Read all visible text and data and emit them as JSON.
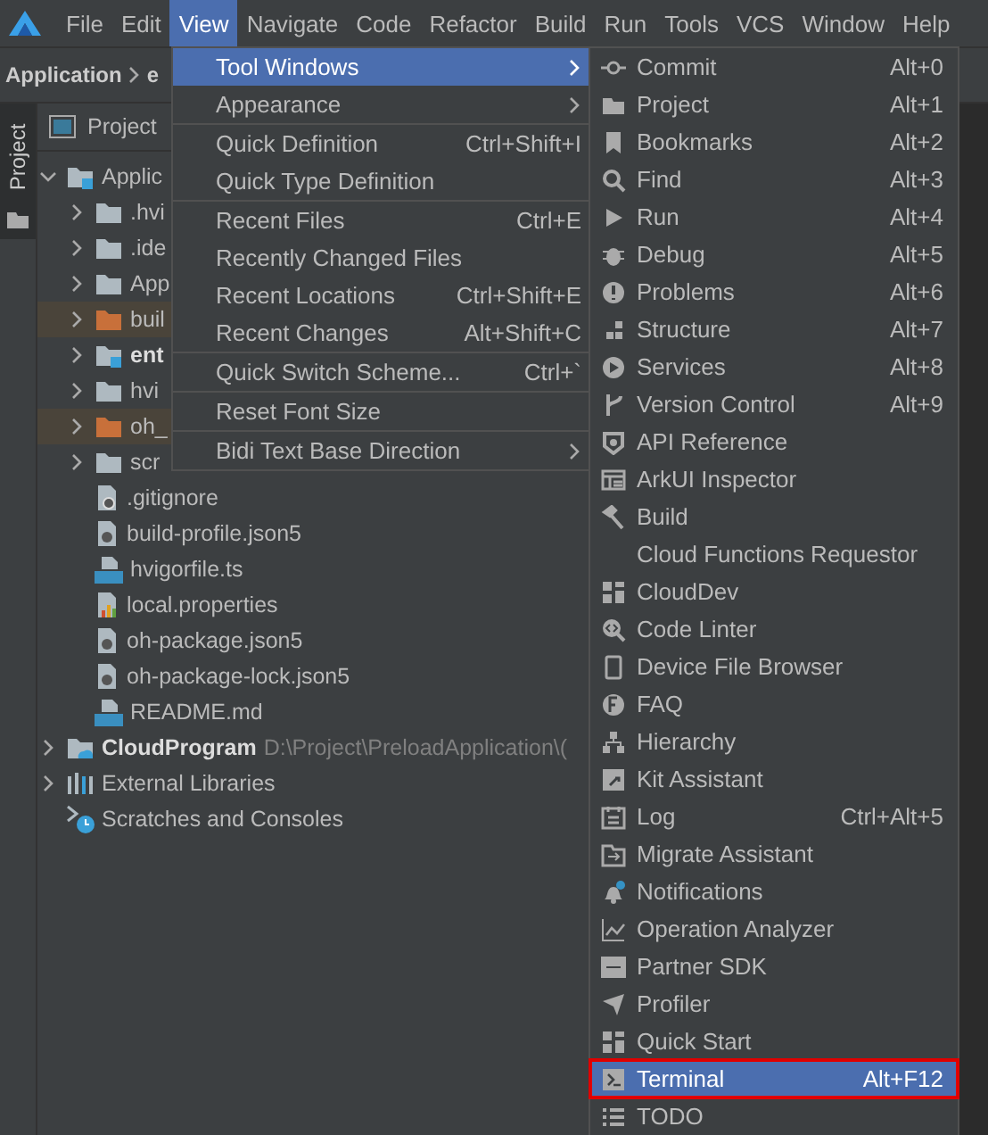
{
  "menu_bar": [
    {
      "label": "File",
      "selected": false
    },
    {
      "label": "Edit",
      "selected": false
    },
    {
      "label": "View",
      "selected": true
    },
    {
      "label": "Navigate",
      "selected": false
    },
    {
      "label": "Code",
      "selected": false
    },
    {
      "label": "Refactor",
      "selected": false
    },
    {
      "label": "Build",
      "selected": false
    },
    {
      "label": "Run",
      "selected": false
    },
    {
      "label": "Tools",
      "selected": false
    },
    {
      "label": "VCS",
      "selected": false
    },
    {
      "label": "Window",
      "selected": false
    },
    {
      "label": "Help",
      "selected": false
    }
  ],
  "breadcrumb": [
    "Application",
    "e"
  ],
  "tool_strip": [
    {
      "label": "Project",
      "selected": true
    }
  ],
  "project_panel": {
    "title": "Project",
    "tree": [
      {
        "label": "Applic",
        "kind": "root",
        "expanded": true,
        "children": [
          {
            "label": ".hvi",
            "kind": "folder",
            "expanded": false,
            "highlighted": false
          },
          {
            "label": ".ide",
            "kind": "folder",
            "expanded": false,
            "highlighted": false
          },
          {
            "label": "App",
            "kind": "folder",
            "expanded": false,
            "highlighted": false
          },
          {
            "label": "buil",
            "kind": "excluded",
            "expanded": false,
            "highlighted": true
          },
          {
            "label": "ent",
            "kind": "module",
            "expanded": false,
            "highlighted": false
          },
          {
            "label": "hvi",
            "kind": "folder",
            "expanded": false,
            "highlighted": false
          },
          {
            "label": "oh_",
            "kind": "excluded",
            "expanded": false,
            "highlighted": true
          },
          {
            "label": "scr",
            "kind": "folder",
            "expanded": false,
            "highlighted": false
          },
          {
            "label": ".gitignore",
            "kind": "ignore",
            "highlighted": false
          },
          {
            "label": "build-profile.json5",
            "kind": "json",
            "highlighted": false
          },
          {
            "label": "hvigorfile.ts",
            "kind": "ts",
            "highlighted": false
          },
          {
            "label": "local.properties",
            "kind": "properties",
            "highlighted": false
          },
          {
            "label": "oh-package.json5",
            "kind": "json",
            "highlighted": false
          },
          {
            "label": "oh-package-lock.json5",
            "kind": "json",
            "highlighted": false
          },
          {
            "label": "README.md",
            "kind": "md",
            "highlighted": false
          }
        ]
      },
      {
        "label": "CloudProgram",
        "path": "D:\\Project\\PreloadApplication\\(",
        "kind": "cloud",
        "expanded": false
      },
      {
        "label": "External Libraries",
        "kind": "libraries",
        "expanded": false
      },
      {
        "label": "Scratches and Consoles",
        "kind": "scratches"
      }
    ]
  },
  "view_menu": [
    {
      "label": "Tool Windows",
      "submenu": true,
      "selected": true
    },
    {
      "label": "Appearance",
      "submenu": true,
      "selected": false,
      "separator_after": true
    },
    {
      "label": "Quick Definition",
      "shortcut": "Ctrl+Shift+I",
      "selected": false
    },
    {
      "label": "Quick Type Definition",
      "selected": false,
      "separator_after": true
    },
    {
      "label": "Recent Files",
      "shortcut": "Ctrl+E",
      "selected": false
    },
    {
      "label": "Recently Changed Files",
      "selected": false
    },
    {
      "label": "Recent Locations",
      "shortcut": "Ctrl+Shift+E",
      "selected": false
    },
    {
      "label": "Recent Changes",
      "shortcut": "Alt+Shift+C",
      "selected": false,
      "separator_after": true
    },
    {
      "label": "Quick Switch Scheme...",
      "shortcut": "Ctrl+`",
      "selected": false,
      "separator_after": true
    },
    {
      "label": "Reset Font Size",
      "selected": false,
      "separator_after": true
    },
    {
      "label": "Bidi Text Base Direction",
      "submenu": true,
      "selected": false
    }
  ],
  "tool_windows_menu": [
    {
      "label": "Commit",
      "shortcut": "Alt+0",
      "selected": false,
      "outlined": false
    },
    {
      "label": "Project",
      "shortcut": "Alt+1",
      "selected": false,
      "outlined": false
    },
    {
      "label": "Bookmarks",
      "shortcut": "Alt+2",
      "selected": false,
      "outlined": false
    },
    {
      "label": "Find",
      "shortcut": "Alt+3",
      "selected": false,
      "outlined": false
    },
    {
      "label": "Run",
      "shortcut": "Alt+4",
      "selected": false,
      "outlined": false
    },
    {
      "label": "Debug",
      "shortcut": "Alt+5",
      "selected": false,
      "outlined": false
    },
    {
      "label": "Problems",
      "shortcut": "Alt+6",
      "selected": false,
      "outlined": false
    },
    {
      "label": "Structure",
      "shortcut": "Alt+7",
      "selected": false,
      "outlined": false
    },
    {
      "label": "Services",
      "shortcut": "Alt+8",
      "selected": false,
      "outlined": false
    },
    {
      "label": "Version Control",
      "shortcut": "Alt+9",
      "selected": false,
      "outlined": false
    },
    {
      "label": "API Reference",
      "selected": false,
      "outlined": false
    },
    {
      "label": "ArkUI Inspector",
      "selected": false,
      "outlined": false
    },
    {
      "label": "Build",
      "selected": false,
      "outlined": false
    },
    {
      "label": "Cloud Functions Requestor",
      "selected": false,
      "outlined": false
    },
    {
      "label": "CloudDev",
      "selected": false,
      "outlined": false
    },
    {
      "label": "Code Linter",
      "selected": false,
      "outlined": false
    },
    {
      "label": "Device File Browser",
      "selected": false,
      "outlined": false
    },
    {
      "label": "FAQ",
      "selected": false,
      "outlined": false
    },
    {
      "label": "Hierarchy",
      "selected": false,
      "outlined": false
    },
    {
      "label": "Kit Assistant",
      "selected": false,
      "outlined": false
    },
    {
      "label": "Log",
      "shortcut": "Ctrl+Alt+5",
      "selected": false,
      "outlined": false
    },
    {
      "label": "Migrate Assistant",
      "selected": false,
      "outlined": false
    },
    {
      "label": "Notifications",
      "selected": false,
      "outlined": false
    },
    {
      "label": "Operation Analyzer",
      "selected": false,
      "outlined": false
    },
    {
      "label": "Partner SDK",
      "selected": false,
      "outlined": false
    },
    {
      "label": "Profiler",
      "selected": false,
      "outlined": false
    },
    {
      "label": "Quick Start",
      "selected": false,
      "outlined": false
    },
    {
      "label": "Terminal",
      "shortcut": "Alt+F12",
      "selected": true,
      "outlined": true
    },
    {
      "label": "TODO",
      "selected": false,
      "outlined": false
    }
  ]
}
